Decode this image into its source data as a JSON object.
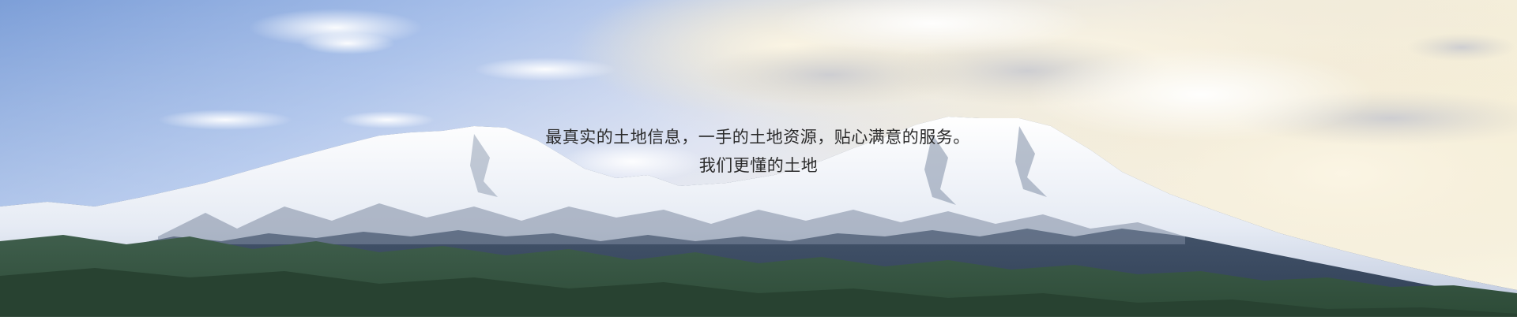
{
  "banner": {
    "slogan_line1": "最真实的土地信息，一手的土地资源，贴心满意的服务。",
    "slogan_line2": "我们更懂的土地"
  }
}
